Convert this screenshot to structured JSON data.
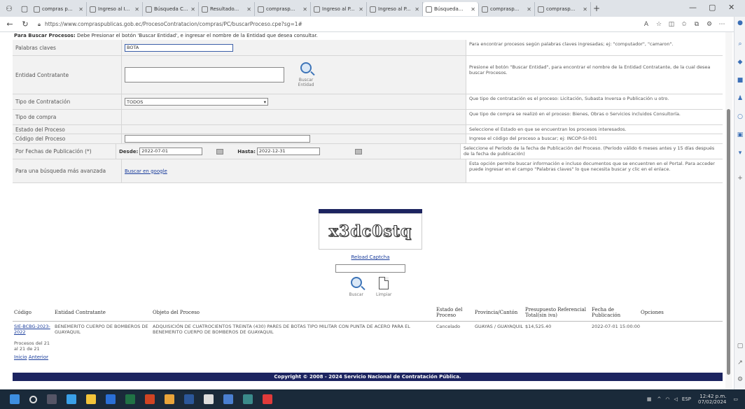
{
  "browser": {
    "tabs": [
      {
        "label": "compras p..."
      },
      {
        "label": "Ingreso al I..."
      },
      {
        "label": "Búsqueda C..."
      },
      {
        "label": "Resultado..."
      },
      {
        "label": "comprasp..."
      },
      {
        "label": "Ingreso al P..."
      },
      {
        "label": "Ingreso al P..."
      },
      {
        "label": "Búsqueda..."
      },
      {
        "label": "comprasp..."
      },
      {
        "label": "comprasp..."
      }
    ],
    "url": "https://www.compraspublicas.gob.ec/ProcesoContratacion/compras/PC/buscarProceso.cpe?sg=1#"
  },
  "form": {
    "instructions_bold": "Para Buscar Procesos:",
    "instructions": "Debe Presionar el botón 'Buscar Entidad', e ingresar el nombre de la Entidad que desea consultar.",
    "keywords_label": "Palabras claves",
    "keywords_value": "BOTA",
    "keywords_help": "Para encontrar procesos según palabras claves ingresadas; ej: \"computador\", \"camaron\".",
    "entity_label": "Entidad Contratante",
    "entity_button": "Buscar Entidad",
    "entity_help": "Presione el botón \"Buscar Entidad\", para encontrar el nombre de la Entidad Contratante, de la cual desea buscar Procesos.",
    "type_label": "Tipo de Contratación",
    "type_value": "TODOS",
    "type_help": "Que tipo de contratación es el proceso: Licitación, Subasta Inversa o Publicación u otro.",
    "purchase_label": "Tipo de compra",
    "purchase_help": "Que tipo de compra se realizó en el proceso: Bienes, Obras o Servicios incluidos Consultoría.",
    "state_label": "Estado del Proceso",
    "state_help": "Seleccione el Estado en que se encuentran los procesos interesados.",
    "code_label": "Código del Proceso",
    "code_help": "Ingrese el código del proceso a buscar; ej: INCOP-SI-001",
    "date_label": "Por Fechas de Publicación (*)",
    "from_label": "Desde:",
    "from_value": "2022-07-01",
    "to_label": "Hasta:",
    "to_value": "2022-12-31",
    "date_help": "Seleccione el Período de la fecha de Publicación del Proceso. (Período válido 6 meses antes y 15 días después de la fecha de publicación)",
    "advanced_label": "Para una búsqueda más avanzada",
    "advanced_link": "Buscar en google",
    "advanced_help": "Esta opción permite buscar información e incluso documentos que se encuentren en el Portal. Para acceder puede ingresar en el campo \"Palabras claves\" lo que necesita buscar y clic en el enlace."
  },
  "captcha": {
    "text": "x3dc0stq",
    "reload_link": "Reload Captcha",
    "search_label": "Buscar",
    "clear_label": "Limpiar"
  },
  "results": {
    "headers": [
      "Código",
      "Entidad Contratante",
      "Objeto del Proceso",
      "Estado del Proceso",
      "Provincia/Cantón",
      "Presupuesto Referencial Total(sin iva)",
      "Fecha de Publicación",
      "Opciones"
    ],
    "rows": [
      {
        "code": "SIE-BCBG-2023-2022",
        "entity": "BENEMERITO CUERPO DE BOMBEROS DE GUAYAQUIL",
        "object": "ADQUISICIÓN DE CUATROCIENTOS TREINTA (430) PARES DE BOTAS TIPO MILITAR CON PUNTA DE ACERO PARA EL BENEMERITO CUERPO DE BOMBEROS DE GUAYAQUIL",
        "state": "Cancelado",
        "province": "GUAYAS / GUAYAQUIL",
        "budget": "$14,525.40",
        "date": "2022-07-01 15:00:00"
      }
    ],
    "page_info": "Procesos del 21 al 21 de 21",
    "first_link": "Inicio",
    "prev_link": "Anterior"
  },
  "footer": "Copyright © 2008 - 2024 Servicio Nacional de Contratación Pública.",
  "taskbar": {
    "time": "12:42 p.m.",
    "date": "07/02/2024",
    "lang": "ESP"
  },
  "colors": {
    "header_bar": "#1c2460",
    "link": "#1a3d9c",
    "form_bg": "#f2f2f2"
  }
}
